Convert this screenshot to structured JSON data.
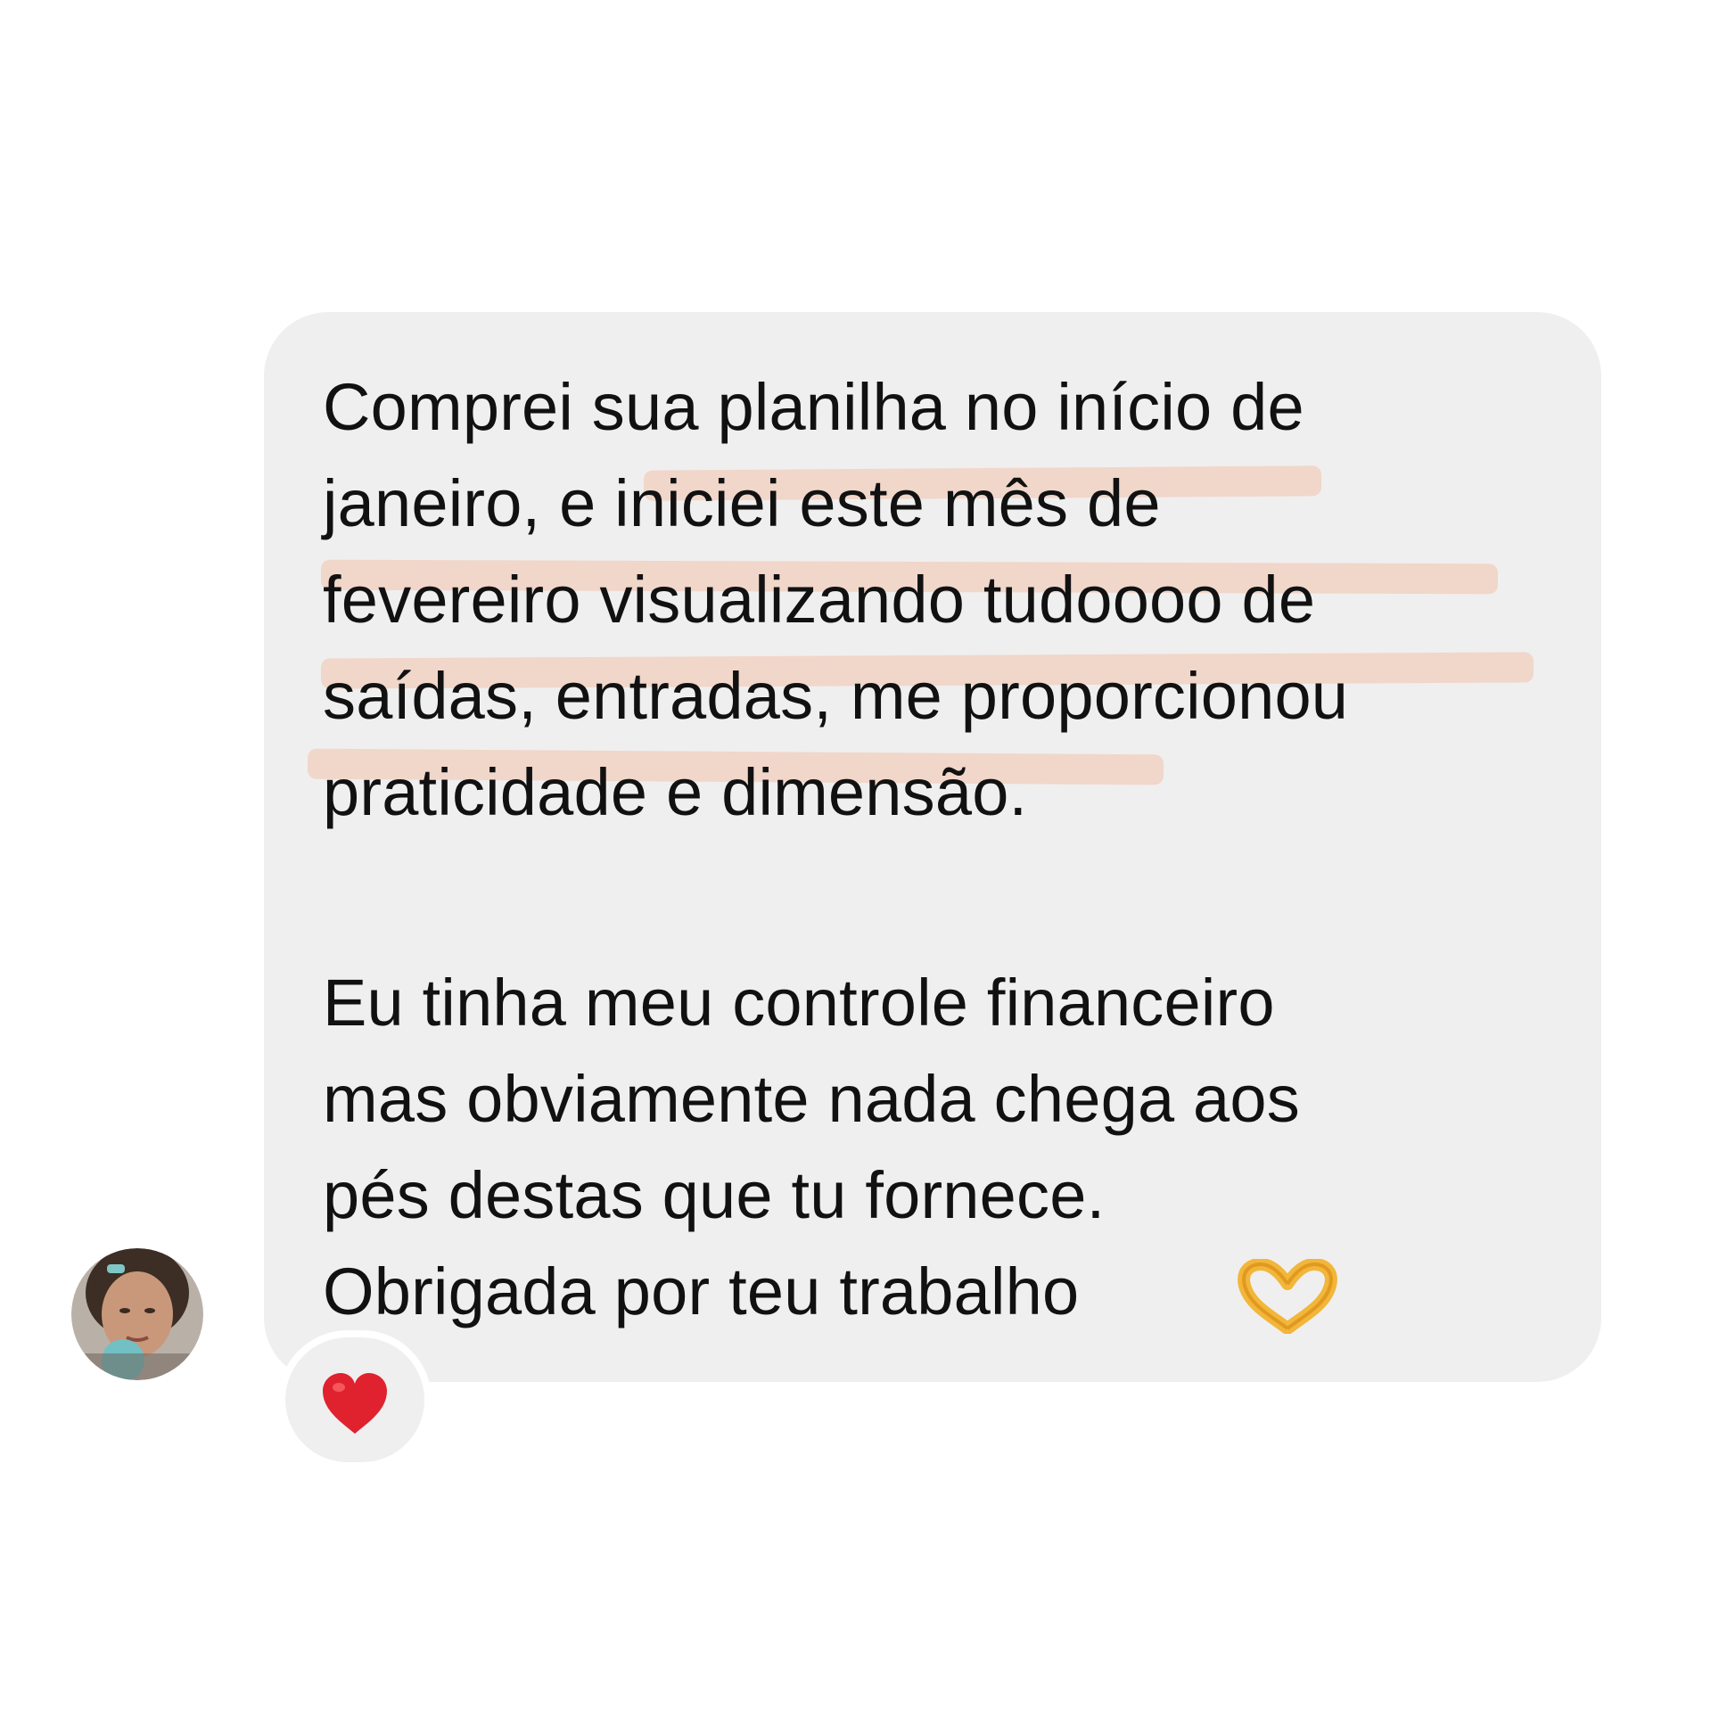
{
  "message": {
    "lines": [
      "Comprei sua planilha no início de",
      "janeiro, e iniciei este mês de",
      "fevereiro visualizando tudoooo de",
      "saídas, entradas, me proporcionou",
      "praticidade e dimensão.",
      "Eu tinha meu controle financeiro",
      "mas obviamente nada chega aos",
      "pés destas que tu fornece.",
      "Obrigada por teu trabalho"
    ],
    "bubble_color": "#efefef",
    "highlight_color": "#f2cdbd",
    "text_color": "#111111"
  },
  "emoji": {
    "heart_hands": "heart-hands-icon",
    "reaction_heart": "red-heart-icon"
  },
  "avatar": {
    "icon": "avatar"
  }
}
